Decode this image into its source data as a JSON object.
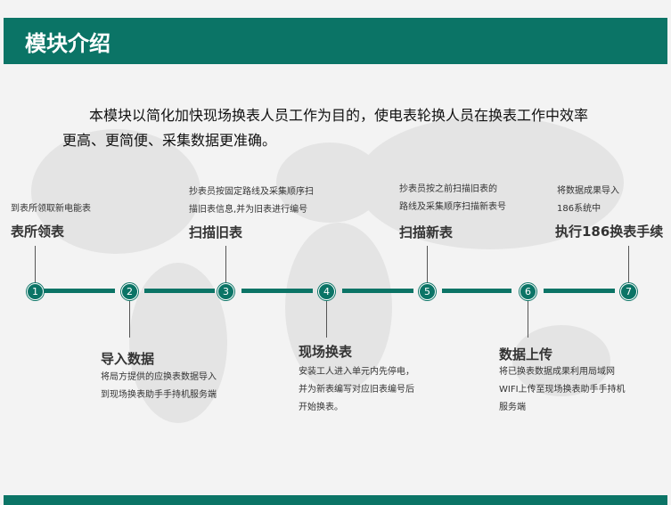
{
  "header": {
    "title": "模块介绍"
  },
  "intro": {
    "text": "本模块以简化加快现场换表人员工作为目的，使电表轮换人员在换表工作中效率更高、更简便、采集数据更准确。"
  },
  "steps": [
    {
      "number": "1",
      "title": "表所领表",
      "desc": [
        "到表所领取新电能表"
      ]
    },
    {
      "number": "2",
      "title": "导入数据",
      "desc": [
        "将局方提供的应换表数据导入",
        "到现场换表助手手持机服务端"
      ]
    },
    {
      "number": "3",
      "title": "扫描旧表",
      "desc": [
        "抄表员按固定路线及采集顺序扫",
        "描旧表信息,并为旧表进行编号"
      ]
    },
    {
      "number": "4",
      "title": "现场换表",
      "desc": [
        "安装工人进入单元内先停电，",
        "并为新表编写对应旧表编号后",
        "开始换表。"
      ]
    },
    {
      "number": "5",
      "title": "扫描新表",
      "desc": [
        "抄表员按之前扫描旧表的",
        "路线及采集顺序扫描新表号"
      ]
    },
    {
      "number": "6",
      "title": "数据上传",
      "desc": [
        "将已换表数据成果利用局域网",
        "WIFI上传至现场换表助手手持机",
        "服务端"
      ]
    },
    {
      "number": "7",
      "title": "执行186换表手续",
      "desc": [
        "将数据成果导入",
        "186系统中"
      ]
    }
  ],
  "colors": {
    "accent": "#0b7466",
    "background": "#f3f3f3"
  }
}
